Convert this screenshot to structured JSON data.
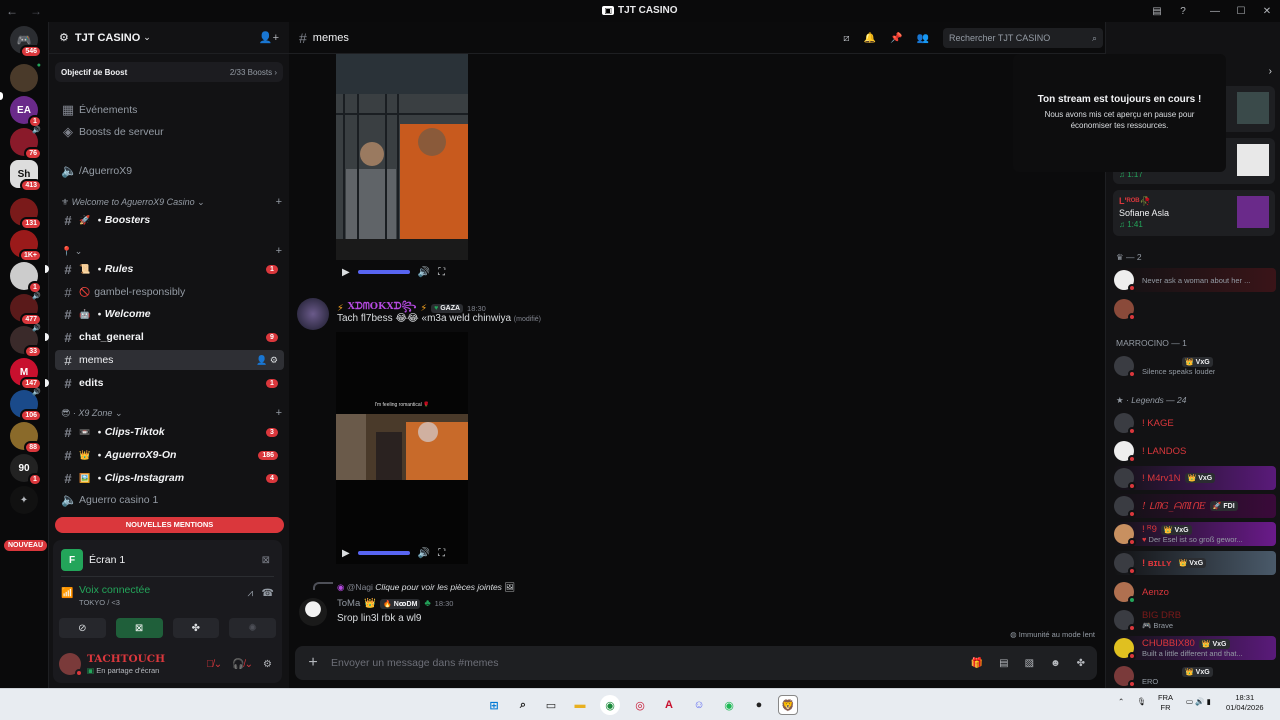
{
  "window": {
    "title": "TJT CASINO",
    "back": "←",
    "forward": "→"
  },
  "rail": {
    "nouveau_label": "NOUVEAU",
    "servers": [
      {
        "badge": "546",
        "color": "#2b2d31",
        "glyph": "💬"
      },
      {
        "badge": "",
        "color": "#4a3a2a",
        "glyph": ""
      },
      {
        "badge": "1",
        "color": "#6a2a8a",
        "glyph": "EA"
      },
      {
        "badge": "76",
        "color": "#8a1a2a",
        "glyph": ""
      },
      {
        "badge": "413",
        "color": "#ddd",
        "glyph": "Sh"
      },
      {
        "badge": "131",
        "color": "#7a1a1a",
        "glyph": ""
      },
      {
        "badge": "1K+",
        "color": "#9a1a1a",
        "glyph": ""
      },
      {
        "badge": "1",
        "color": "#ccc",
        "glyph": ""
      },
      {
        "badge": "477",
        "color": "#5a1a1a",
        "glyph": ""
      },
      {
        "badge": "33",
        "color": "#3a2a2a",
        "glyph": ""
      },
      {
        "badge": "147",
        "color": "#c8102e",
        "glyph": "M"
      },
      {
        "badge": "106",
        "color": "#1a4a8a",
        "glyph": ""
      },
      {
        "badge": "88",
        "color": "#8a6a2a",
        "glyph": ""
      },
      {
        "badge": "1",
        "color": "#222",
        "glyph": "90"
      },
      {
        "badge": "",
        "color": "#111",
        "glyph": "✦"
      }
    ]
  },
  "sidebar": {
    "guild_name": "TJT CASINO",
    "boost_label": "Objectif de Boost",
    "boost_count": "2/33 Boosts",
    "events": "Événements",
    "server_boosts": "Boosts de serveur",
    "voice_top": "/AguerroX9",
    "cat1": "Welcome to AguerroX9 Casino",
    "cat2": "",
    "cat3": "X9 Zone",
    "voice_bottom": "Aguerro casino 1",
    "channels": [
      {
        "label": "Boosters",
        "emoji": "🚀",
        "dot": "・",
        "count": ""
      },
      {
        "label": "Rules",
        "emoji": "📜",
        "dot": "・",
        "count": "1"
      },
      {
        "label": "gambel-responsibly",
        "emoji": "🚫",
        "dot": "",
        "count": ""
      },
      {
        "label": "Welcome",
        "emoji": "🤖",
        "dot": "・",
        "count": ""
      },
      {
        "label": "chat_general",
        "emoji": "",
        "dot": "",
        "count": "9"
      },
      {
        "label": "memes",
        "emoji": "",
        "dot": "",
        "count": ""
      },
      {
        "label": "edits",
        "emoji": "",
        "dot": "",
        "count": "1"
      },
      {
        "label": "Clips-Tiktok",
        "emoji": "📼",
        "dot": "・",
        "count": "3"
      },
      {
        "label": "AguerroX9-On",
        "emoji": "👑",
        "dot": "・",
        "count": "186"
      },
      {
        "label": "Clips-Instagram",
        "emoji": "🖼️",
        "dot": "・",
        "count": "4"
      }
    ],
    "mentions": "NOUVELLES MENTIONS"
  },
  "panel": {
    "screen": "Écran 1",
    "voice_status": "Voix connectée",
    "voice_sub": "TOKYO / <3",
    "username": "TACHTOUCH",
    "user_status": "En partage d'écran"
  },
  "chat": {
    "channel": "memes",
    "search_placeholder": "Rechercher TJT CASINO",
    "messages": [
      {
        "author": "XᗪᗰOKXᗪ꧂",
        "tag": "GAZA",
        "time": "18:30",
        "body": "Tach fl7bess 😂😂 «m3a weld chinwiya",
        "edited": "(modifié)"
      },
      {
        "reply_to": "@Nagi",
        "reply_text": "Clique pour voir les pièces jointes",
        "author": "ToMa",
        "tag": "NꝏDM",
        "time": "18:30",
        "body": "Srop lin3l rbk a wl9"
      }
    ],
    "video_caption": "I'm feeling romantical 🌹",
    "immunity": "Immunité au mode lent",
    "composer_placeholder": "Envoyer un message dans #memes"
  },
  "overlay": {
    "title": "Ton stream est toujours en cours !",
    "body": "Nous avons mis cet aperçu en pause pour économiser tes ressources."
  },
  "members": {
    "activity1_time": "♫ 1:17",
    "activity2_name": "L'ᴿᴼᴮ🥀",
    "activity2_user": "Sofiane Asla",
    "activity2_time": "♫ 1:41",
    "group_mid": "♛ — 2",
    "group_marrocino": "MARROCINO — 1",
    "group_legends": "Legends — 24",
    "list": [
      {
        "name": "",
        "status": "Never ask a woman about her ...",
        "color": "#949ba4",
        "tag": ""
      },
      {
        "name": "",
        "status": "",
        "color": "#949ba4",
        "tag": ""
      },
      {
        "name": "",
        "status": "Silence speaks louder",
        "color": "#949ba4",
        "tag": "VxG"
      },
      {
        "name": "! KAGE",
        "status": "",
        "color": "#da373c",
        "tag": ""
      },
      {
        "name": "! LANDOS",
        "status": "",
        "color": "#da373c",
        "tag": ""
      },
      {
        "name": "! M4rv1N",
        "status": "",
        "color": "#da373c",
        "tag": "VxG"
      },
      {
        "name": "! ᒪᗰG_ᗩᗰIᑎE",
        "status": "",
        "color": "#da373c",
        "tag": "FDI"
      },
      {
        "name": "! ᴿ9",
        "status": "Der Esel ist so groß gewor...",
        "color": "#da373c",
        "tag": "VxG"
      },
      {
        "name": "! ʙɪʟʟʏ",
        "status": "",
        "color": "#da373c",
        "tag": "VxG"
      },
      {
        "name": "Aenzo",
        "status": "",
        "color": "#da373c",
        "tag": ""
      },
      {
        "name": "BIG DRB",
        "status": "🎮 Brave",
        "color": "#7a1a1a",
        "tag": ""
      },
      {
        "name": "CHUBBIX80",
        "status": "Built a little different and that...",
        "color": "#da373c",
        "tag": "VxG"
      },
      {
        "name": "",
        "status": "ERO",
        "color": "#da373c",
        "tag": "VxG"
      }
    ]
  },
  "taskbar": {
    "lang1": "FRA",
    "lang2": "FR",
    "time": "18:31",
    "date": "01/04/2026"
  }
}
